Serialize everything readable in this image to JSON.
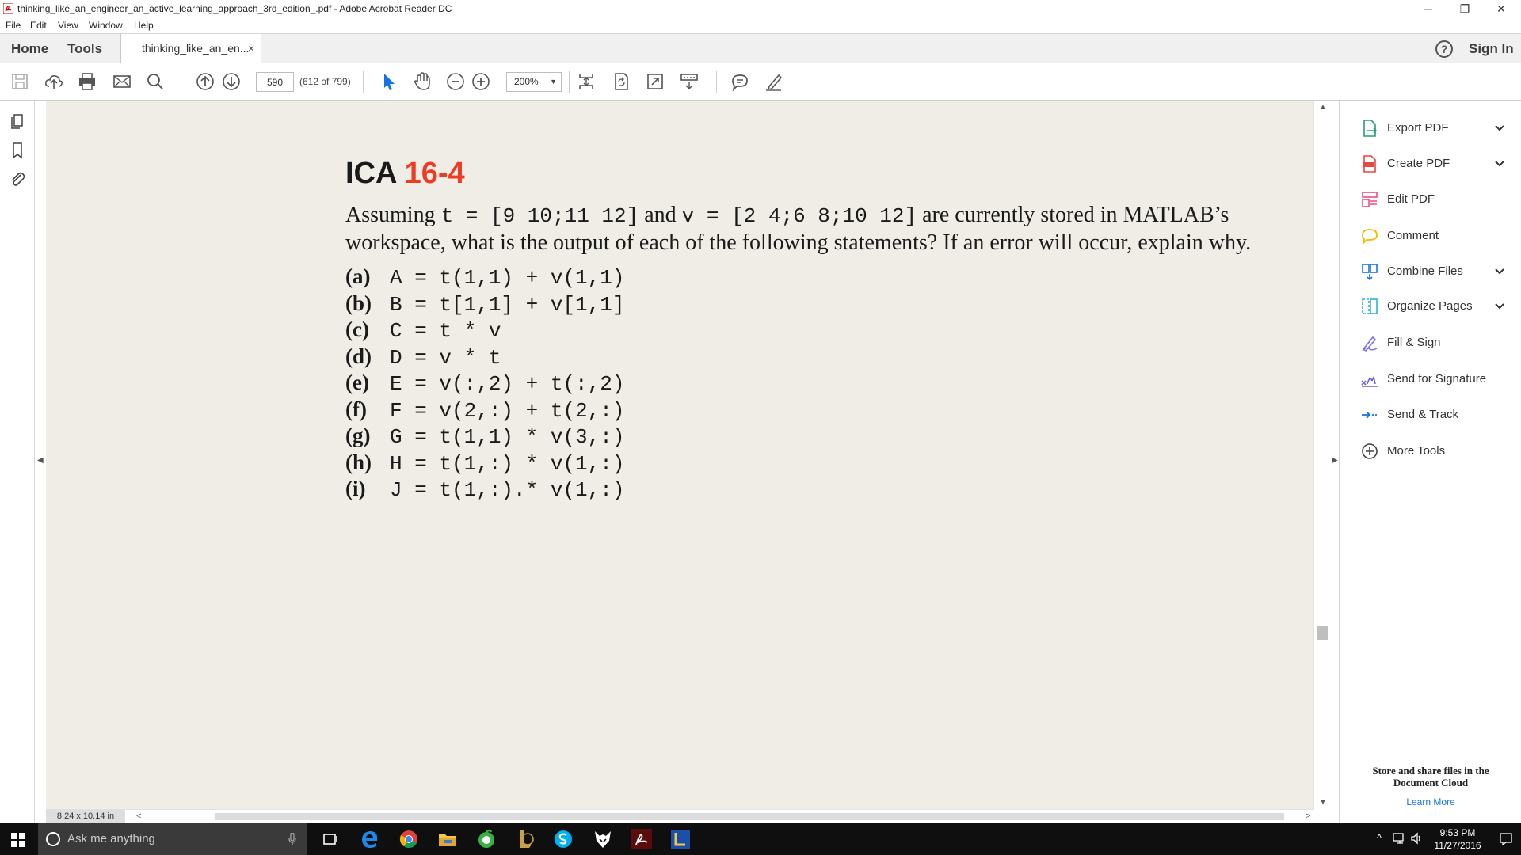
{
  "window": {
    "title": "thinking_like_an_engineer_an_active_learning_approach_3rd_edition_.pdf - Adobe Acrobat Reader DC",
    "controls": [
      "─",
      "❐",
      "✕"
    ]
  },
  "menu": [
    "File",
    "Edit",
    "View",
    "Window",
    "Help"
  ],
  "tabs": {
    "home": "Home",
    "tools": "Tools",
    "document": "thinking_like_an_en...",
    "close": "×",
    "help": "?",
    "sign_in": "Sign In"
  },
  "toolbar": {
    "page_number": "590",
    "page_count": "(612 of 799)",
    "zoom": "200%"
  },
  "document": {
    "heading_prefix": "ICA ",
    "heading_number": "16-4",
    "question": {
      "p1": "Assuming ",
      "t_assign": "t = [9  10;11  12]",
      "p2": " and ",
      "v_assign": "v = [2  4;6  8;10  12]",
      "p3": " are currently stored in MATLAB’s workspace, what is the output of each of the following statements? If an error will occur, explain why."
    },
    "items": [
      {
        "label": "(a)",
        "expr": "A = t(1,1) + v(1,1)"
      },
      {
        "label": "(b)",
        "expr": "B = t[1,1] + v[1,1]"
      },
      {
        "label": "(c)",
        "expr": "C = t * v"
      },
      {
        "label": "(d)",
        "expr": "D = v * t"
      },
      {
        "label": "(e)",
        "expr": "E = v(:,2) + t(:,2)"
      },
      {
        "label": "(f)",
        "expr": "F = v(2,:) + t(2,:)"
      },
      {
        "label": "(g)",
        "expr": "G = t(1,1) * v(3,:)"
      },
      {
        "label": "(h)",
        "expr": "H = t(1,:) * v(1,:)"
      },
      {
        "label": "(i)",
        "expr": "J = t(1,:).* v(1,:)"
      }
    ]
  },
  "status": {
    "page_size": "8.24 x 10.14 in"
  },
  "tools_pane": {
    "items": [
      {
        "label": "Export PDF",
        "icon": "export-pdf-icon",
        "color": "#2a9d6f"
      },
      {
        "label": "Create PDF",
        "icon": "create-pdf-icon",
        "color": "#e5483f"
      },
      {
        "label": "Edit PDF",
        "icon": "edit-pdf-icon",
        "color": "#ea4c89"
      },
      {
        "label": "Comment",
        "icon": "comment-icon",
        "color": "#f5b800"
      },
      {
        "label": "Combine Files",
        "icon": "combine-files-icon",
        "color": "#1473e6"
      },
      {
        "label": "Organize Pages",
        "icon": "organize-pages-icon",
        "color": "#2eb3d8"
      },
      {
        "label": "Fill & Sign",
        "icon": "fill-sign-icon",
        "color": "#7b6fe8"
      },
      {
        "label": "Send for Signature",
        "icon": "send-signature-icon",
        "color": "#6b5ee0"
      },
      {
        "label": "Send & Track",
        "icon": "send-track-icon",
        "color": "#1473e6"
      },
      {
        "label": "More Tools",
        "icon": "more-tools-icon",
        "color": "#444444"
      }
    ],
    "cloud_text": "Store and share files in the Document Cloud",
    "learn_more": "Learn More"
  },
  "taskbar": {
    "search_placeholder": "Ask me anything",
    "time": "9:53 PM",
    "date": "11/27/2016"
  },
  "colors": {
    "accent_red": "#ee3b24",
    "page_bg": "#f0ede6",
    "taskbar": "#0f0f0f"
  }
}
